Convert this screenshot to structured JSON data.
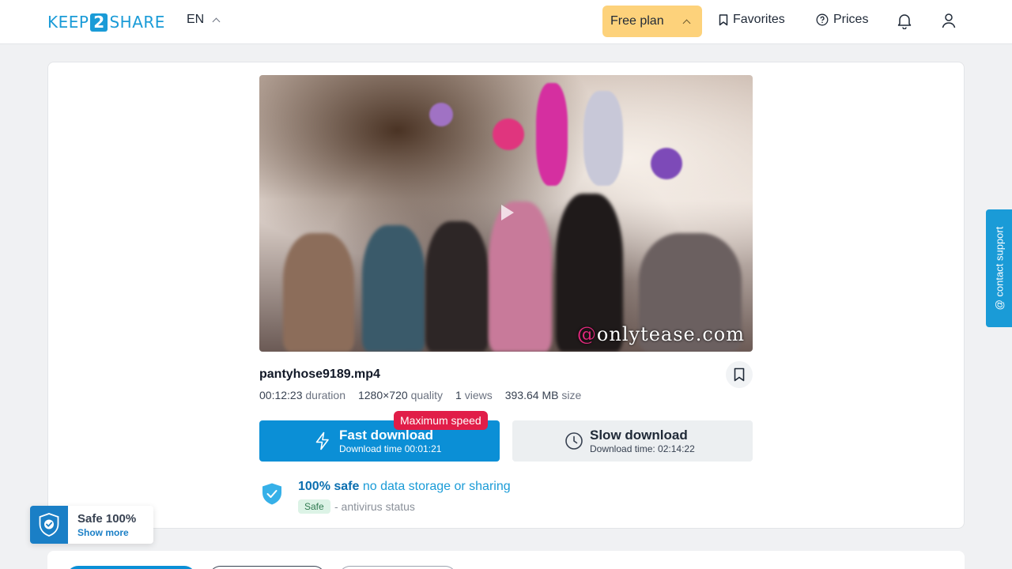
{
  "header": {
    "logo": {
      "left": "KEEP",
      "middle": "2",
      "right": "SHARE"
    },
    "language": "EN",
    "plan_label": "Free plan",
    "favorites_label": "Favorites",
    "prices_label": "Prices"
  },
  "file": {
    "name": "pantyhose9189.mp4",
    "watermark_prefix": "@",
    "watermark": "onlytease.com",
    "duration": "00:12:23",
    "duration_label": "duration",
    "resolution": "1280×720",
    "resolution_label": "quality",
    "views": "1",
    "views_label": "views",
    "size": "393.64 MB",
    "size_label": "size"
  },
  "downloads": {
    "fast": {
      "title": "Fast download",
      "subtitle": "Download time 00:01:21",
      "badge": "Maximum speed"
    },
    "slow": {
      "title": "Slow download",
      "subtitle": "Download time: 02:14:22"
    }
  },
  "safety": {
    "headline_bold": "100% safe",
    "headline_rest": "no data storage or sharing",
    "tag": "Safe",
    "status": "- antivirus status"
  },
  "support": {
    "label": "@ contact support"
  },
  "badge": {
    "title": "Safe 100%",
    "link": "Show more"
  },
  "colors": {
    "accent": "#1a9bd7",
    "fast_button": "#0b8fd6",
    "plan": "#fdd27b",
    "max_speed": "#e11d48"
  }
}
